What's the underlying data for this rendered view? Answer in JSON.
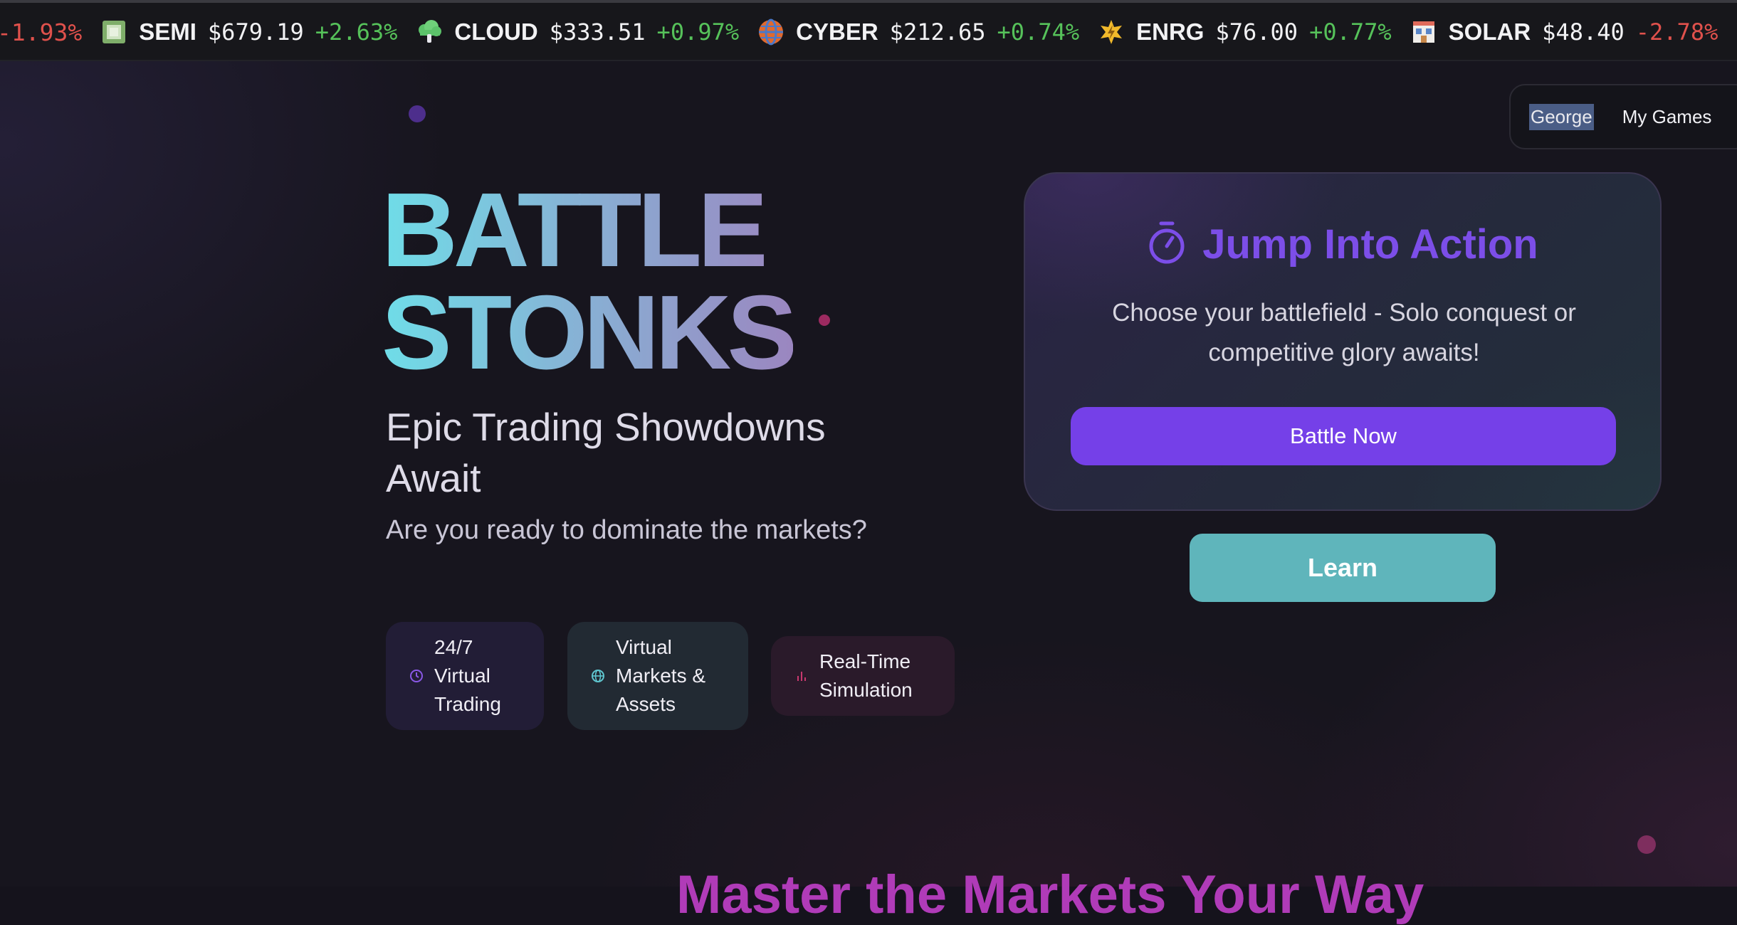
{
  "ticker": {
    "lead_change": "-1.93%",
    "items": [
      {
        "symbol": "SEMI",
        "price": "$679.19",
        "change": "+2.63%",
        "direction": "up",
        "icon": "microchip-icon"
      },
      {
        "symbol": "CLOUD",
        "price": "$333.51",
        "change": "+0.97%",
        "direction": "up",
        "icon": "cloud-icon"
      },
      {
        "symbol": "CYBER",
        "price": "$212.65",
        "change": "+0.74%",
        "direction": "up",
        "icon": "globe-icon"
      },
      {
        "symbol": "ENRG",
        "price": "$76.00",
        "change": "+0.77%",
        "direction": "up",
        "icon": "lightning-icon"
      },
      {
        "symbol": "SOLAR",
        "price": "$48.40",
        "change": "-2.78%",
        "direction": "down",
        "icon": "solar-panel-icon"
      }
    ],
    "colors": {
      "up": "#56c25a",
      "down": "#e0514c"
    }
  },
  "nav": {
    "user": "George",
    "my_games": "My Games"
  },
  "hero": {
    "title_line1": "BATTLE",
    "title_line2": "STONKS",
    "subtitle": "Epic Trading Showdowns Await",
    "tagline": "Are you ready to dominate the markets?",
    "features": [
      {
        "label": "24/7 Virtual Trading",
        "icon": "clock-icon"
      },
      {
        "label": "Virtual Markets & Assets",
        "icon": "globe-icon"
      },
      {
        "label": "Real-Time Simulation",
        "icon": "bar-chart-icon"
      }
    ]
  },
  "action_card": {
    "title": "Jump Into Action",
    "icon": "stopwatch-icon",
    "description": "Choose your battlefield - Solo conquest or competitive glory awaits!",
    "battle_button": "Battle Now"
  },
  "learn_button": "Learn",
  "next_section_title": "Master the Markets Your Way",
  "colors": {
    "accent_purple": "#7540e8",
    "teal": "#5fb5bb",
    "magenta": "#b03bb8",
    "background": "#17151e"
  }
}
